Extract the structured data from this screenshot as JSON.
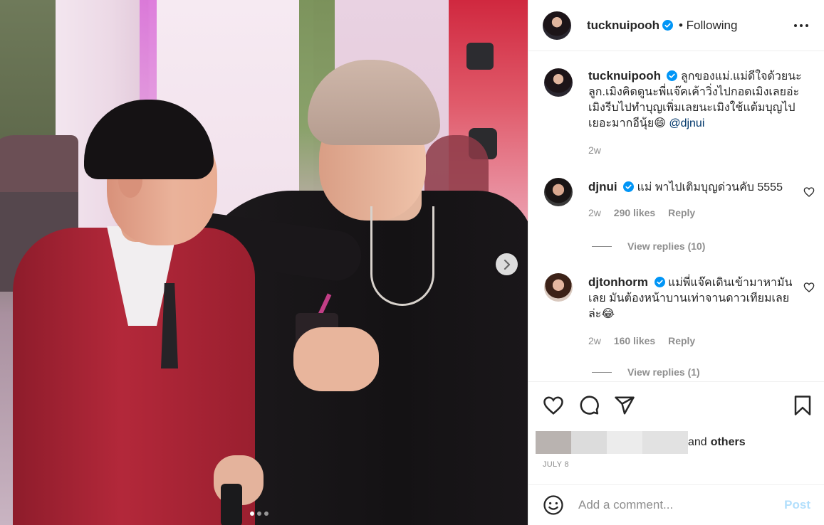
{
  "post": {
    "author": "tucknuipooh",
    "follow_status": "• Following",
    "carousel": {
      "total_slides": 3,
      "active_index": 0
    }
  },
  "caption": {
    "username": "tucknuipooh",
    "text": "ลูกของแม่.แม่ดีใจด้วยนะลูก.เมิงคิดดูนะพี่แจ๊คเค้าวิ่งไปกอดเมิงเลยอ่ะเมิงรีบไปทำบุญเพิ่มเลยนะเมิงใช้แต้มบุญไปเยอะมากอีนุ้ย😄",
    "mention": "@djnui",
    "time": "2w"
  },
  "comments": [
    {
      "username": "djnui",
      "text": "แม่ พาไปเติมบุญด่วนคับ 5555",
      "time": "2w",
      "likes": "290 likes",
      "reply": "Reply",
      "view_replies": "View replies (10)"
    },
    {
      "username": "djtonhorm",
      "text": "แม่พี่แจ๊คเดินเข้ามาหามันเลย มันต้องหน้าบานเท่าจานดาวเทียมเลยล่ะ😂",
      "time": "2w",
      "likes": "160 likes",
      "reply": "Reply",
      "view_replies": "View replies (1)"
    }
  ],
  "likes": {
    "prefix": "and",
    "others": "others"
  },
  "date": "JULY 8",
  "composer": {
    "placeholder": "Add a comment...",
    "post_label": "Post"
  },
  "colors": {
    "verified": "#0095f6",
    "mention": "#00376b",
    "muted": "#8e8e8e",
    "post_disabled": "#b2dffc"
  },
  "icons": [
    "verified-badge-icon",
    "more-options-icon",
    "heart-icon",
    "comment-icon",
    "share-icon",
    "bookmark-icon",
    "emoji-icon",
    "chevron-right-icon"
  ]
}
